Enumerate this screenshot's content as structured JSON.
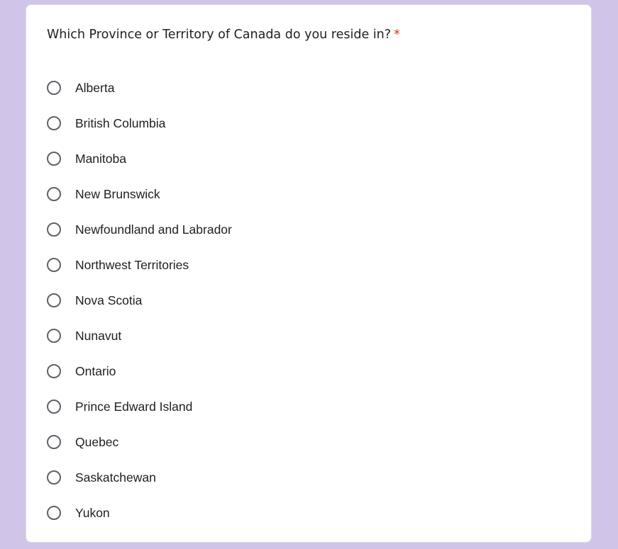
{
  "question": {
    "text": "Which Province or Territory of Canada do you reside in?",
    "required_marker": "*"
  },
  "options": [
    {
      "label": "Alberta"
    },
    {
      "label": "British Columbia"
    },
    {
      "label": "Manitoba"
    },
    {
      "label": "New Brunswick"
    },
    {
      "label": "Newfoundland and Labrador"
    },
    {
      "label": "Northwest Territories"
    },
    {
      "label": "Nova Scotia"
    },
    {
      "label": "Nunavut"
    },
    {
      "label": "Ontario"
    },
    {
      "label": "Prince Edward Island"
    },
    {
      "label": "Quebec"
    },
    {
      "label": "Saskatchewan"
    },
    {
      "label": "Yukon"
    }
  ],
  "colors": {
    "background": "#d1c4e9",
    "card": "#ffffff",
    "required": "#d93025",
    "radio_border": "#5f6368",
    "text": "#202124"
  }
}
